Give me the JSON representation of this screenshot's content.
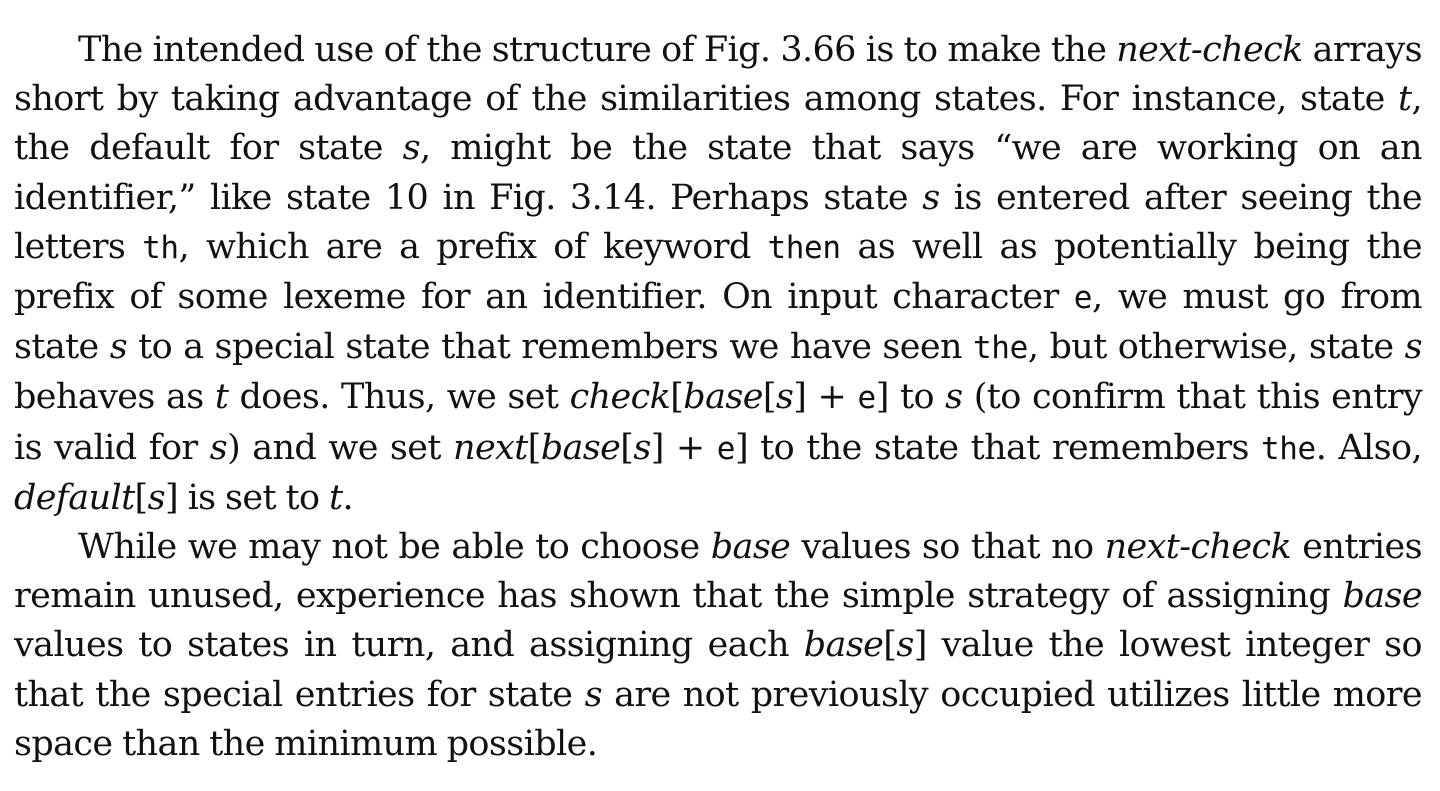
{
  "paragraphs": [
    {
      "id": "p1",
      "runs": [
        {
          "t": "The intended use of the structure of Fig. 3.66 is to make the "
        },
        {
          "t": "next-check",
          "s": "i"
        },
        {
          "t": " arrays short by taking advantage of the similarities among states. For instance, state "
        },
        {
          "t": "t",
          "s": "i"
        },
        {
          "t": ", the default for state "
        },
        {
          "t": "s",
          "s": "i"
        },
        {
          "t": ", might be the state that says “we are working on an identifier,” like state 10 in Fig. 3.14. Perhaps state "
        },
        {
          "t": "s",
          "s": "i"
        },
        {
          "t": " is entered after seeing the letters "
        },
        {
          "t": "th",
          "s": "m"
        },
        {
          "t": ", which are a prefix of keyword "
        },
        {
          "t": "then",
          "s": "m"
        },
        {
          "t": " as well as potentially being the prefix of some lexeme for an identifier. On input character "
        },
        {
          "t": "e",
          "s": "m"
        },
        {
          "t": ", we must go from state "
        },
        {
          "t": "s",
          "s": "i"
        },
        {
          "t": " to a special state that remembers we have seen "
        },
        {
          "t": "the",
          "s": "m"
        },
        {
          "t": ", but otherwise, state "
        },
        {
          "t": "s",
          "s": "i"
        },
        {
          "t": " behaves as "
        },
        {
          "t": "t",
          "s": "i"
        },
        {
          "t": " does. Thus, we set "
        },
        {
          "t": "check",
          "s": "i"
        },
        {
          "t": "["
        },
        {
          "t": "base",
          "s": "i"
        },
        {
          "t": "["
        },
        {
          "t": "s",
          "s": "i"
        },
        {
          "t": "] + "
        },
        {
          "t": "e",
          "s": "m"
        },
        {
          "t": "] to "
        },
        {
          "t": "s",
          "s": "i"
        },
        {
          "t": " (to confirm that this entry is valid for "
        },
        {
          "t": "s",
          "s": "i"
        },
        {
          "t": ") and we set "
        },
        {
          "t": "next",
          "s": "i"
        },
        {
          "t": "["
        },
        {
          "t": "base",
          "s": "i"
        },
        {
          "t": "["
        },
        {
          "t": "s",
          "s": "i"
        },
        {
          "t": "] + "
        },
        {
          "t": "e",
          "s": "m"
        },
        {
          "t": "] to the state that remembers "
        },
        {
          "t": "the",
          "s": "m"
        },
        {
          "t": ". Also, "
        },
        {
          "t": "default",
          "s": "i"
        },
        {
          "t": "["
        },
        {
          "t": "s",
          "s": "i"
        },
        {
          "t": "] is set to "
        },
        {
          "t": "t",
          "s": "i"
        },
        {
          "t": "."
        }
      ]
    },
    {
      "id": "p2",
      "runs": [
        {
          "t": "While we may not be able to choose "
        },
        {
          "t": "base",
          "s": "i"
        },
        {
          "t": " values so that no "
        },
        {
          "t": "next-check",
          "s": "i"
        },
        {
          "t": " entries remain unused, experience has shown that the simple strategy of assigning "
        },
        {
          "t": "base",
          "s": "i"
        },
        {
          "t": " values to states in turn, and assigning each "
        },
        {
          "t": "base",
          "s": "i"
        },
        {
          "t": "["
        },
        {
          "t": "s",
          "s": "i"
        },
        {
          "t": "] value the lowest integer so that the special entries for state "
        },
        {
          "t": "s",
          "s": "i"
        },
        {
          "t": " are not previously occupied utilizes little more space than the minimum possible."
        }
      ]
    }
  ]
}
